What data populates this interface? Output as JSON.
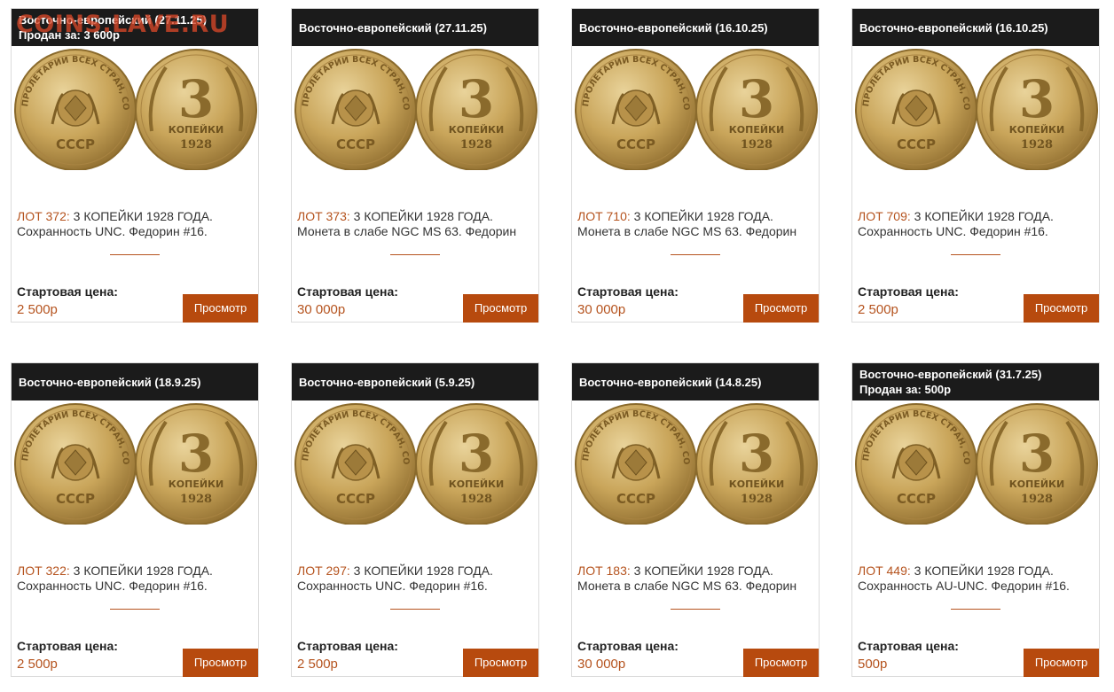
{
  "watermark": "COINS.LAVE.RU",
  "coin_texts": {
    "obverse_legend": "ПРОЛЕТАРИИ ВСЕХ СТРАН, СОЕДИНЯЙТЕСЬ!",
    "obverse_bottom": "СССР",
    "reverse_denomination": "3",
    "reverse_word": "КОПЕЙКИ",
    "reverse_year": "1928"
  },
  "colors": {
    "accent": "#b5531e",
    "button": "#b74a0e",
    "header_bg": "#1b1b1b",
    "coin_gold": "#c9a55a"
  },
  "lots": [
    {
      "header": "Восточно-европейский (27.11.25)",
      "sold": "Продан за: 3 600р",
      "lot": "ЛОТ 372:",
      "title": "3 КОПЕЙКИ 1928 ГОДА.",
      "desc": "Сохранность UNC. Федорин #16.",
      "price_label": "Стартовая цена:",
      "price": "2 500р",
      "button": "Просмотр"
    },
    {
      "header": "Восточно-европейский (27.11.25)",
      "sold": "",
      "lot": "ЛОТ 373:",
      "title": "3 КОПЕЙКИ 1928 ГОДА.",
      "desc": "Монета в слабе NGC MS 63. Федорин",
      "price_label": "Стартовая цена:",
      "price": "30 000р",
      "button": "Просмотр"
    },
    {
      "header": "Восточно-европейский (16.10.25)",
      "sold": "",
      "lot": "ЛОТ 710:",
      "title": "3 КОПЕЙКИ 1928 ГОДА.",
      "desc": "Монета в слабе NGC MS 63. Федорин",
      "price_label": "Стартовая цена:",
      "price": "30 000р",
      "button": "Просмотр"
    },
    {
      "header": "Восточно-европейский (16.10.25)",
      "sold": "",
      "lot": "ЛОТ 709:",
      "title": "3 КОПЕЙКИ 1928 ГОДА.",
      "desc": "Сохранность UNC. Федорин #16.",
      "price_label": "Стартовая цена:",
      "price": "2 500р",
      "button": "Просмотр"
    },
    {
      "header": "Восточно-европейский (18.9.25)",
      "sold": "",
      "lot": "ЛОТ 322:",
      "title": "3 КОПЕЙКИ 1928 ГОДА.",
      "desc": "Сохранность UNC. Федорин #16.",
      "price_label": "Стартовая цена:",
      "price": "2 500р",
      "button": "Просмотр"
    },
    {
      "header": "Восточно-европейский (5.9.25)",
      "sold": "",
      "lot": "ЛОТ 297:",
      "title": "3 КОПЕЙКИ 1928 ГОДА.",
      "desc": "Сохранность UNC. Федорин #16.",
      "price_label": "Стартовая цена:",
      "price": "2 500р",
      "button": "Просмотр"
    },
    {
      "header": "Восточно-европейский (14.8.25)",
      "sold": "",
      "lot": "ЛОТ 183:",
      "title": "3 КОПЕЙКИ 1928 ГОДА.",
      "desc": "Монета в слабе NGC MS 63. Федорин",
      "price_label": "Стартовая цена:",
      "price": "30 000р",
      "button": "Просмотр"
    },
    {
      "header": "Восточно-европейский (31.7.25)",
      "sold": "Продан за: 500р",
      "lot": "ЛОТ 449:",
      "title": "3 КОПЕЙКИ 1928 ГОДА.",
      "desc": "Сохранность AU-UNC. Федорин #16.",
      "price_label": "Стартовая цена:",
      "price": "500р",
      "button": "Просмотр"
    }
  ]
}
